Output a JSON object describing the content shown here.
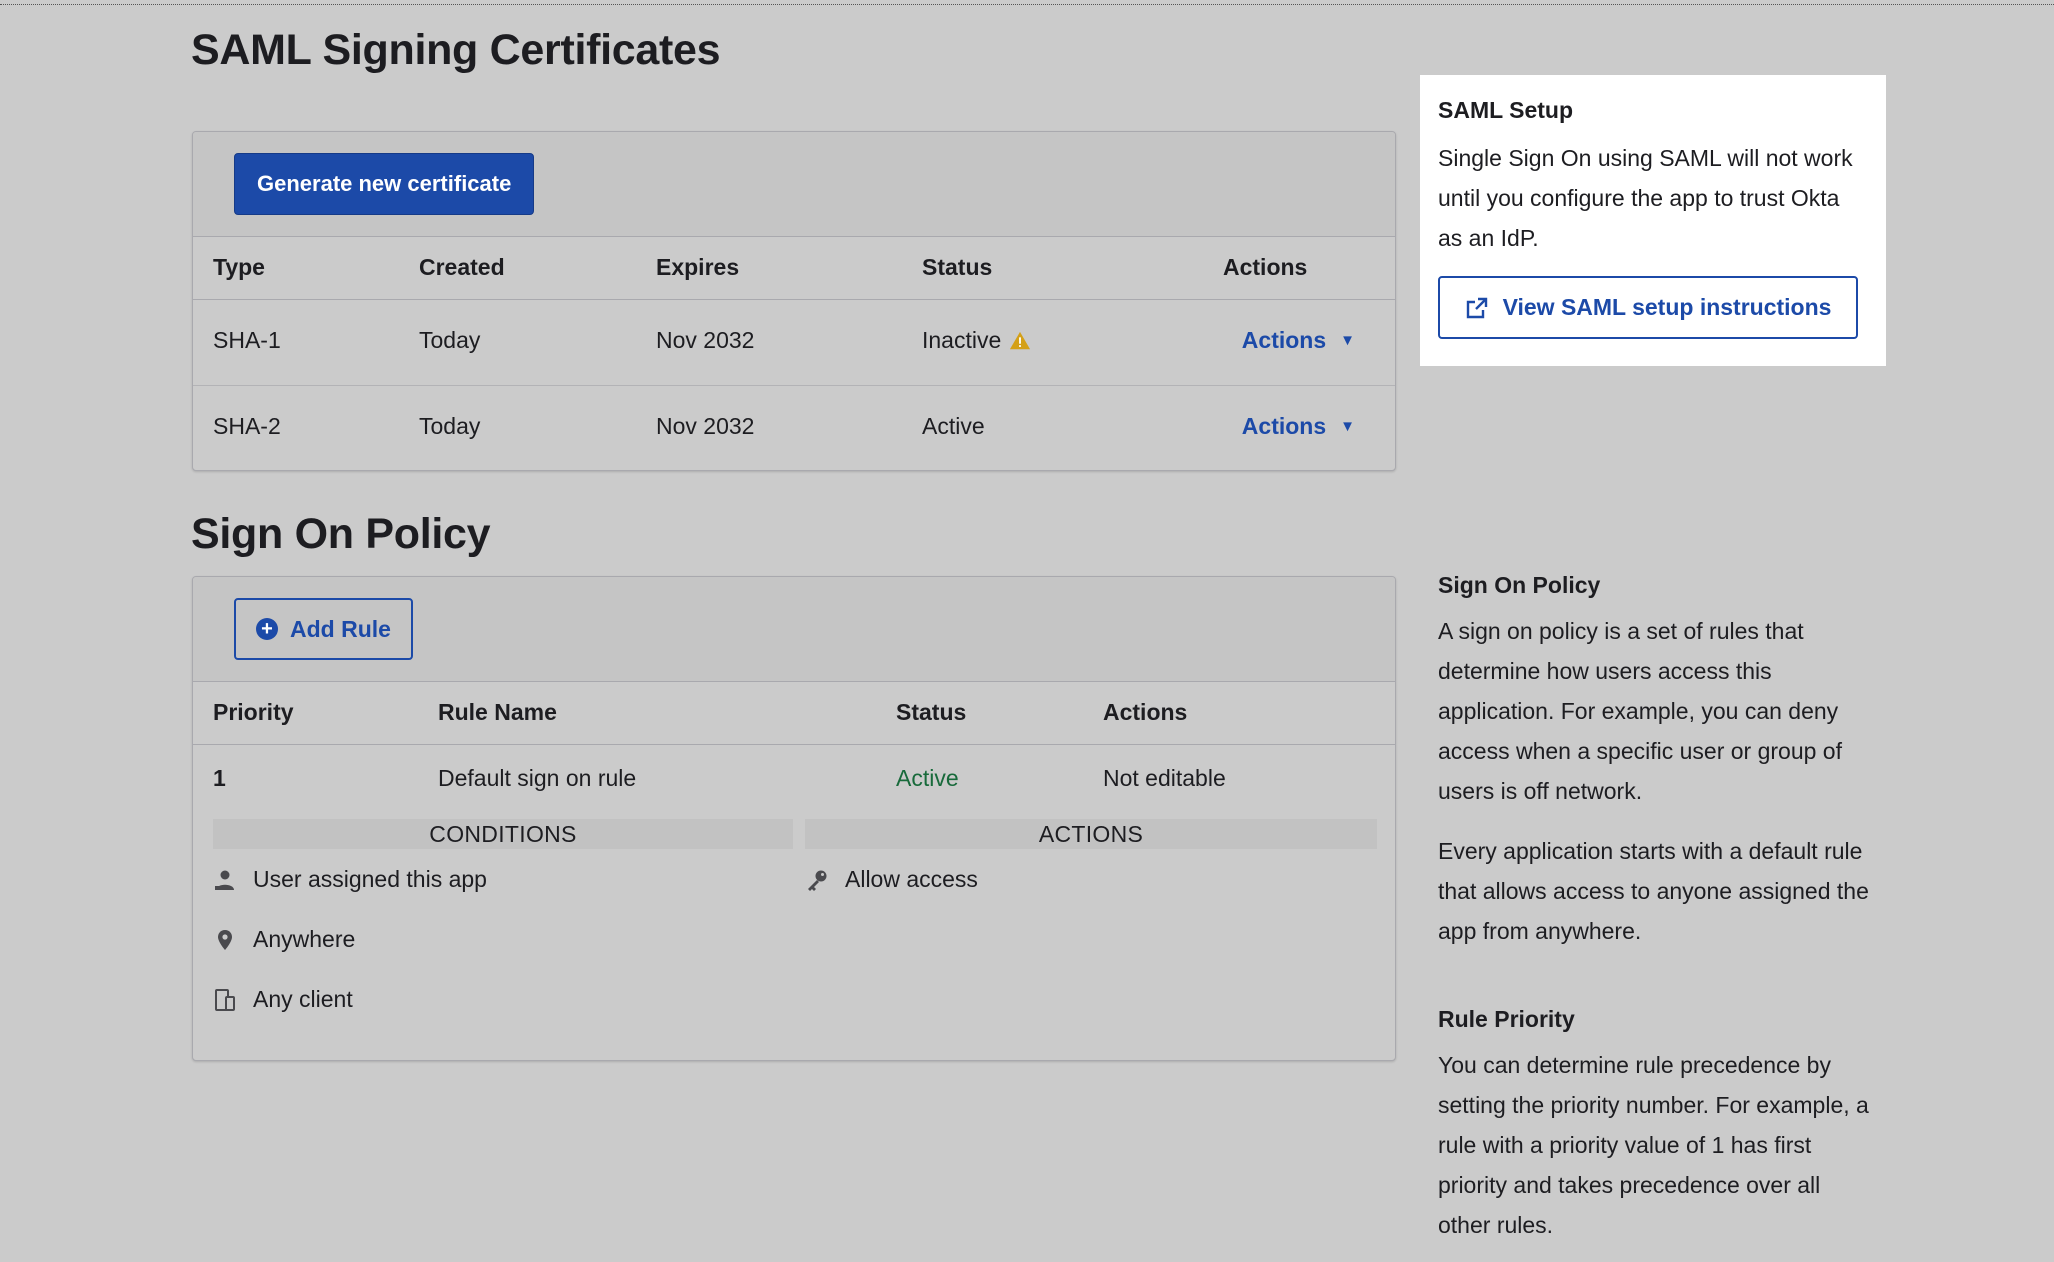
{
  "certificates": {
    "title": "SAML Signing Certificates",
    "generate_button": "Generate new certificate",
    "columns": [
      "Type",
      "Created",
      "Expires",
      "Status",
      "Actions"
    ],
    "rows": [
      {
        "type": "SHA-1",
        "created": "Today",
        "expires": "Nov 2032",
        "status": "Inactive",
        "action": "Actions",
        "warning_icon": "warning-icon"
      },
      {
        "type": "SHA-2",
        "created": "Today",
        "expires": "Nov 2032",
        "status": "Active",
        "action": "Actions"
      }
    ]
  },
  "policy": {
    "title": "Sign On Policy",
    "add_button": "Add Rule",
    "columns": [
      "Priority",
      "Rule Name",
      "Status",
      "Actions"
    ],
    "rule": {
      "priority": "1",
      "name": "Default sign on rule",
      "status": "Active",
      "action": "Not editable",
      "conditions_header": "CONDITIONS",
      "actions_header": "ACTIONS",
      "conditions": [
        {
          "icon": "user-icon",
          "text": "User assigned this app"
        },
        {
          "icon": "location-pin-icon",
          "text": "Anywhere"
        },
        {
          "icon": "device-icon",
          "text": "Any client"
        }
      ],
      "actions": [
        {
          "icon": "key-icon",
          "text": "Allow access"
        }
      ]
    }
  },
  "sidebar": {
    "saml_setup": {
      "title": "SAML Setup",
      "text": "Single Sign On using SAML will not work until you configure the app to trust Okta as an IdP.",
      "button": "View SAML setup instructions"
    },
    "policy_help": {
      "title": "Sign On Policy",
      "paragraph1": "A sign on policy is a set of rules that determine how users access this application. For example, you can deny access when a specific user or group of users is off network.",
      "paragraph2": "Every application starts with a default rule that allows access to anyone assigned the app from anywhere."
    },
    "priority_help": {
      "title": "Rule Priority",
      "text": "You can determine rule precedence by setting the priority number. For example, a rule with a priority value of 1 has first priority and takes precedence over all other rules."
    }
  },
  "colors": {
    "background": "#cbcbcb",
    "primary": "#1c4aa8",
    "active_green": "#186a3b",
    "warning": "#d4a017"
  }
}
